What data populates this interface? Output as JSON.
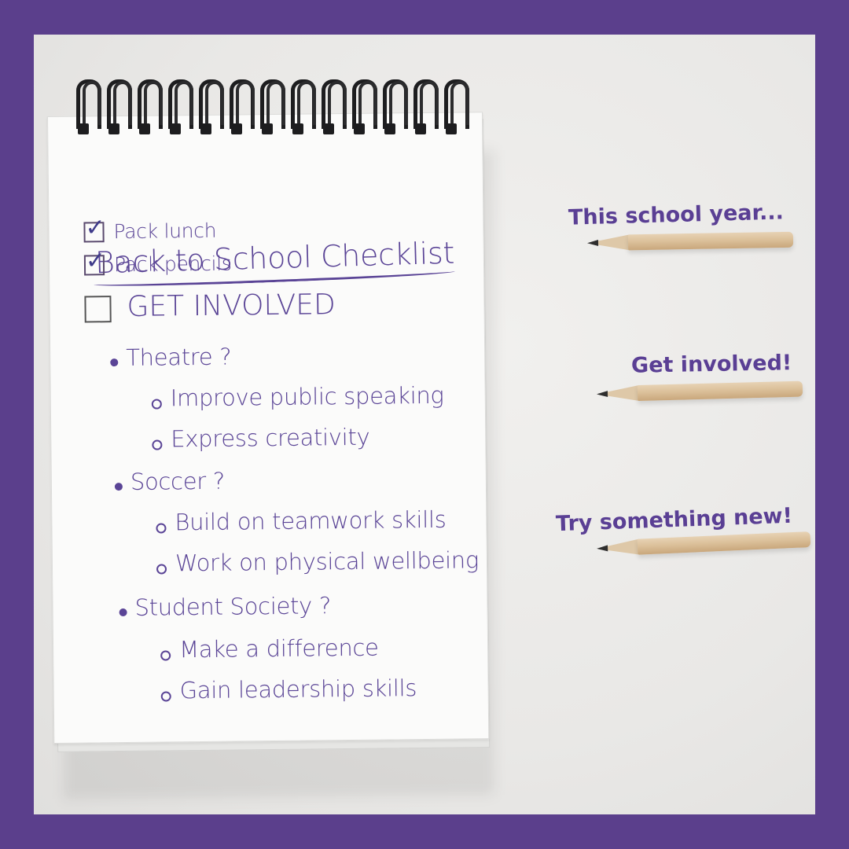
{
  "notepad": {
    "title": "Back to School Checklist",
    "checked_items": [
      "Pack lunch",
      "Pack pencils"
    ],
    "main_item": "GET INVOLVED",
    "groups": [
      {
        "label": "Theatre ?",
        "subs": [
          "Improve public speaking",
          "Express creativity"
        ]
      },
      {
        "label": "Soccer ?",
        "subs": [
          "Build on teamwork skills",
          "Work on physical wellbeing"
        ]
      },
      {
        "label": "Student Society ?",
        "subs": [
          "Make a difference",
          "Gain leadership skills"
        ]
      }
    ]
  },
  "captions": [
    "This school year...",
    "Get involved!",
    "Try something new!"
  ],
  "colors": {
    "frame": "#5b3f8c",
    "text": "#5a4496",
    "caption": "#5a3f94"
  },
  "icons": [
    "checkmark-icon",
    "checkbox-icon",
    "bullet-icon",
    "circle-bullet-icon",
    "pencil-icon",
    "spiral-ring-icon"
  ]
}
